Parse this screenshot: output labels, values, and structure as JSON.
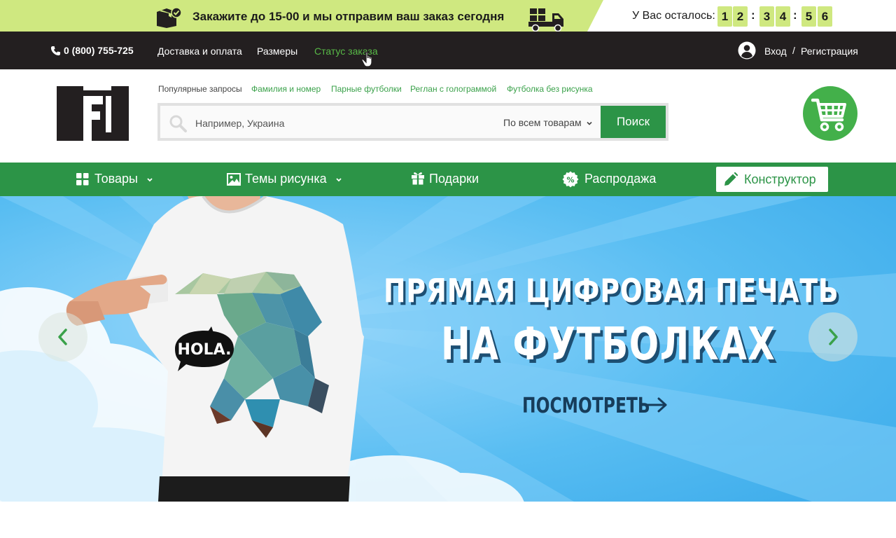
{
  "promo": {
    "text": "Закажите до 15-00 и мы отправим ваш заказ сегодня",
    "timer_label": "У Вас осталось:",
    "timer_digits": [
      "1",
      "2",
      "3",
      "4",
      "5",
      "6"
    ],
    "timer_separator": ":"
  },
  "topnav": {
    "phone": "0 (800) 755-725",
    "links": [
      "Доставка и оплата",
      "Размеры",
      "Статус заказа"
    ],
    "active_link": "Статус заказа",
    "login": "Вход",
    "separator": "/",
    "register": "Регистрация"
  },
  "header": {
    "popular_label": "Популярные запросы",
    "popular_links": [
      "Фамилия и номер",
      "Парные футболки",
      "Реглан с голограммой",
      "Футболка без рисунка"
    ],
    "search_placeholder": "Например, Украина",
    "search_scope": "По всем товарам",
    "search_button": "Поиск"
  },
  "catnav": {
    "items": [
      "Товары",
      "Темы рисунка",
      "Подарки",
      "Распродажа"
    ],
    "constructor": "Конструктор"
  },
  "hero": {
    "title_line1": "ПРЯМАЯ ЦИФРОВАЯ ПЕЧАТЬ",
    "title_line2": "НА ФУТБОЛКАХ",
    "cta": "ПОСМОТРЕТЬ",
    "shirt_print_text": "HOLA."
  },
  "icons": {
    "promo_box": "box-check-icon",
    "promo_truck": "delivery-truck-icon",
    "phone": "phone-icon",
    "user": "user-circle-icon",
    "search": "search-icon",
    "cart": "shopping-cart-icon",
    "products": "grid-icon",
    "themes": "image-icon",
    "gifts": "gift-icon",
    "sale": "percent-badge-icon",
    "constructor": "pencil-icon"
  },
  "colors": {
    "promo_bg": "#cfe880",
    "dark_nav": "#231f20",
    "brand_green": "#2c9447",
    "link_green": "#3aa14a",
    "cart_green": "#43b04a",
    "hero_sky": "#53bdf4"
  }
}
